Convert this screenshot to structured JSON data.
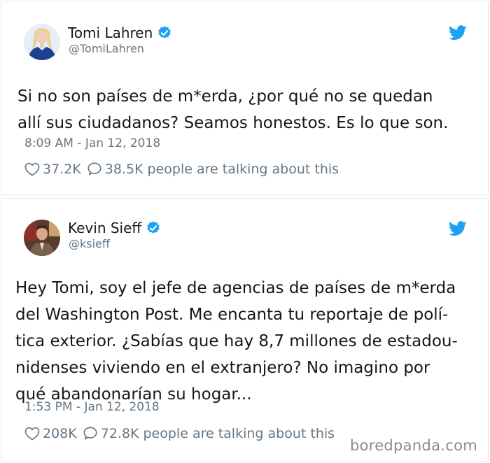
{
  "tweets": [
    {
      "display_name": "Tomi Lahren",
      "handle": "@TomiLahren",
      "verified": true,
      "text": "Si no son países de m*erda, ¿por qué no se quedan\nallí sus ciudadanos? Seamos honestos. Es lo que son.",
      "timestamp": "8:09 AM - Jan 12, 2018",
      "likes": "37.2K",
      "replies": "38.5K",
      "talking_label": "people are talking about this"
    },
    {
      "display_name": "Kevin Sieff",
      "handle": "@ksieff",
      "verified": true,
      "text": "Hey Tomi, soy el jefe de agencias de países de m*erda\ndel Washington Post. Me encanta tu reportaje de polí-\ntica exterior. ¿Sabías que hay 8,7 millones de estadou-\nnidenses viviendo en el extranjero? No imagino por\nqué abandonarían su hogar...",
      "timestamp": "1:53 PM - Jan 12, 2018",
      "likes": "208K",
      "replies": "72.8K",
      "talking_label": "people are talking about this"
    }
  ],
  "watermark": "boredpanda.com",
  "colors": {
    "text": "#14171a",
    "secondary": "#657786",
    "twitter_blue": "#1da1f2",
    "border": "#e1e8ed"
  },
  "icons": [
    "verified-badge-icon",
    "twitter-bird-icon",
    "heart-icon",
    "reply-bubble-icon"
  ]
}
